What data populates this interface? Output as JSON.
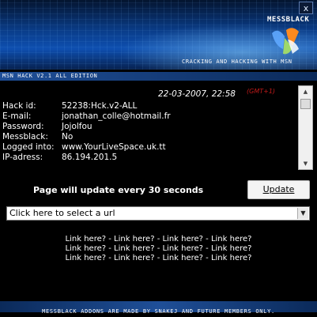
{
  "window": {
    "close_label": "x",
    "brand": "MESSBLACK",
    "tagline": "CRACKING AND HACKING WITH MSN",
    "edition": "MSN HACK V2.1 ALL EDITION"
  },
  "info": {
    "datetime": "22-03-2007, 22:58",
    "timezone": "(GMT+1)",
    "rows": [
      {
        "label": "Hack id:",
        "value": "52238:Hck.v2-ALL"
      },
      {
        "label": "E-mail:",
        "value": "jonathan_colle@hotmail.fr"
      },
      {
        "label": "Password:",
        "value": "Jojolfou"
      },
      {
        "label": "Messblack:",
        "value": "No"
      },
      {
        "label": "Logged into:",
        "value": "www.YourLiveSpace.uk.tt"
      },
      {
        "label": "IP-adress:",
        "value": "86.194.201.5"
      }
    ]
  },
  "update": {
    "message": "Page will update every 30 seconds",
    "button_label": "Update"
  },
  "url_select": {
    "selected": "Click here to select a url"
  },
  "links": {
    "rows": [
      [
        "Link here?",
        "Link here?",
        "Link here?",
        "Link here?"
      ],
      [
        "Link here?",
        "Link here?",
        "Link here?",
        "Link here?"
      ],
      [
        "Link here?",
        "Link here?",
        "Link here?",
        "Link here?"
      ]
    ]
  },
  "footer": {
    "text": "MESSBLACK ADDONS ARE MADE BY SNAKEJ AND FUTURE MEMBERS ONLY."
  },
  "colors": {
    "background": "#000000",
    "header_blue": "#0e4fb0",
    "timezone_red": "#c21a1a"
  }
}
